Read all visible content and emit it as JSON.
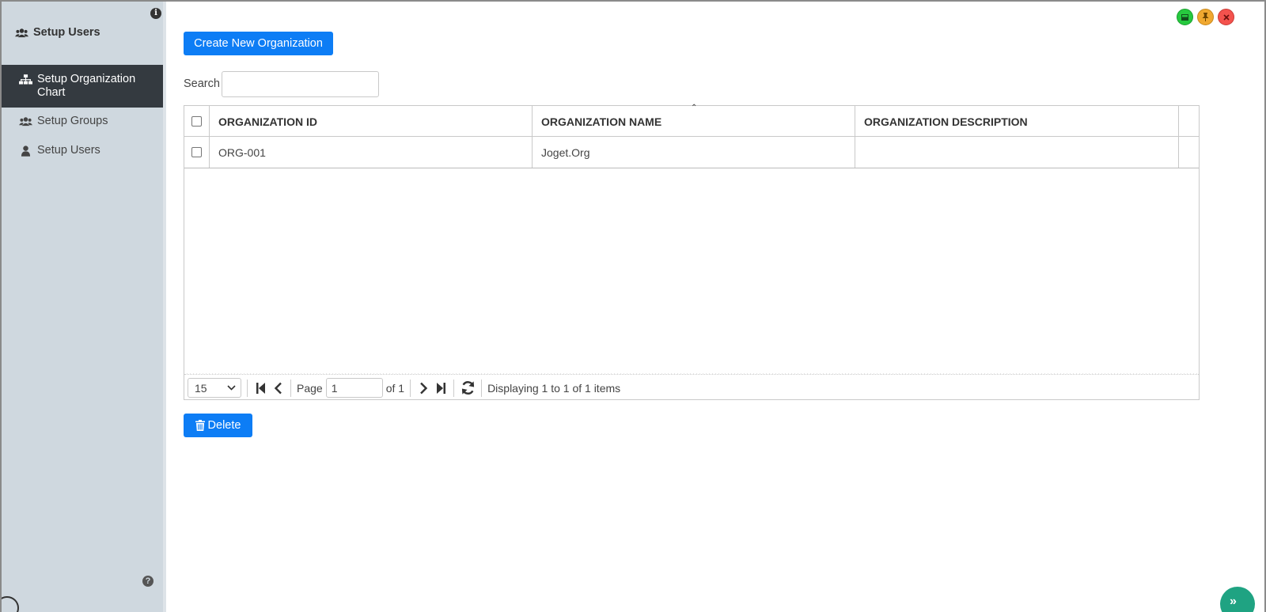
{
  "sidebar": {
    "title": "Setup Users",
    "items": [
      {
        "label": "Setup Organization Chart",
        "icon": "sitemap-icon",
        "active": true
      },
      {
        "label": "Setup Groups",
        "icon": "users-icon",
        "active": false
      },
      {
        "label": "Setup Users",
        "icon": "user-icon",
        "active": false
      }
    ]
  },
  "toolbar": {
    "create_label": "Create New Organization",
    "delete_label": "Delete",
    "search_label": "Search",
    "search_value": ""
  },
  "table": {
    "columns": [
      "ORGANIZATION ID",
      "ORGANIZATION NAME",
      "ORGANIZATION DESCRIPTION"
    ],
    "rows": [
      {
        "id": "ORG-001",
        "name": "Joget.Org",
        "description": ""
      }
    ]
  },
  "pager": {
    "page_size": "15",
    "page_label": "Page",
    "page_value": "1",
    "of_label": "of 1",
    "status": "Displaying 1 to 1 of 1 items"
  },
  "colors": {
    "primary": "#0d7df5",
    "sidebar_bg": "#cfd8df",
    "sidebar_active": "#343a40",
    "win_green": "#27c93f",
    "win_orange": "#f0a830",
    "win_red": "#f4524d"
  }
}
